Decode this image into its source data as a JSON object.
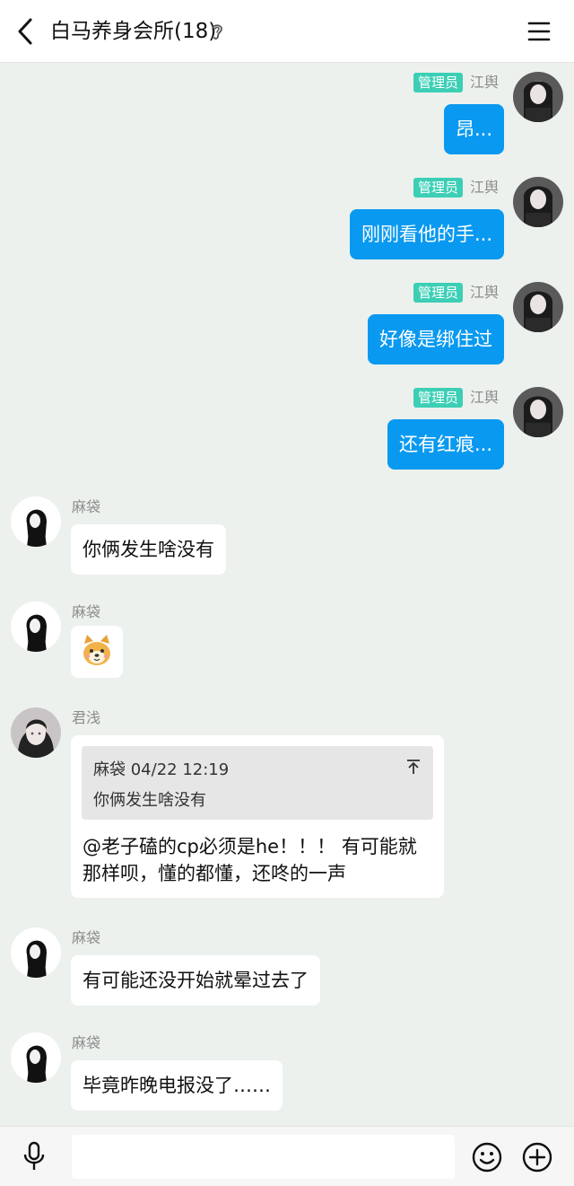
{
  "header": {
    "title": "白马养身会所(18)"
  },
  "messages": [
    {
      "side": "right",
      "badge": "管理员",
      "name": "江舆",
      "text": "昂..."
    },
    {
      "side": "right",
      "badge": "管理员",
      "name": "江舆",
      "text": "刚刚看他的手..."
    },
    {
      "side": "right",
      "badge": "管理员",
      "name": "江舆",
      "text": "好像是绑住过"
    },
    {
      "side": "right",
      "badge": "管理员",
      "name": "江舆",
      "text": "还有红痕..."
    },
    {
      "side": "left",
      "name": "麻袋",
      "text": "你俩发生啥没有"
    },
    {
      "side": "left",
      "name": "麻袋",
      "sticker": "dog-face-emoji"
    },
    {
      "side": "left",
      "name": "君浅",
      "quote": {
        "sender": "麻袋",
        "time": "04/22 12:19",
        "text": "你俩发生啥没有"
      },
      "text": "@老子磕的cp必须是he！！！ 有可能就那样呗，懂的都懂，还咚的一声"
    },
    {
      "side": "left",
      "name": "麻袋",
      "text": "有可能还没开始就晕过去了"
    },
    {
      "side": "left",
      "name": "麻袋",
      "text": "毕竟昨晚电报没了……"
    }
  ],
  "icons": {
    "back": "back-arrow-icon",
    "ear": "ear-icon",
    "menu": "menu-icon",
    "mic": "microphone-icon",
    "emoji": "smile-icon",
    "plus": "plus-icon",
    "quote_jump": "jump-to-original-icon"
  },
  "input": {
    "value": ""
  },
  "colors": {
    "chat_bg": "#ecf1ed",
    "self_bubble": "#0a99f0",
    "admin_badge": "#3ccfb5",
    "other_bubble": "#ffffff"
  }
}
